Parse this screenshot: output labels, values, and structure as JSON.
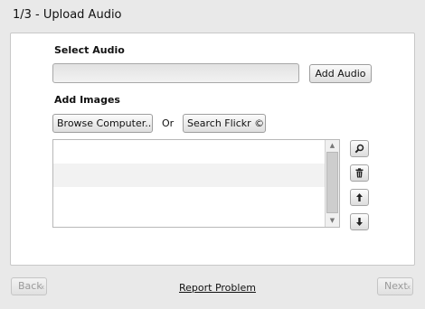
{
  "window": {
    "title": "1/3 - Upload Audio"
  },
  "audio": {
    "section_label": "Select Audio",
    "file_value": "",
    "add_button": "Add Audio"
  },
  "images": {
    "section_label": "Add Images",
    "browse_button": "Browse Computer..",
    "or_text": "Or",
    "flickr_button": "Search Flickr ©",
    "list_items": []
  },
  "side_buttons": {
    "preview": "magnifier-icon",
    "delete": "trash-icon",
    "up": "arrow-up-icon",
    "down": "arrow-down-icon"
  },
  "footer": {
    "back_button": "Back",
    "report_link": "Report Problem",
    "next_button": "Next"
  }
}
